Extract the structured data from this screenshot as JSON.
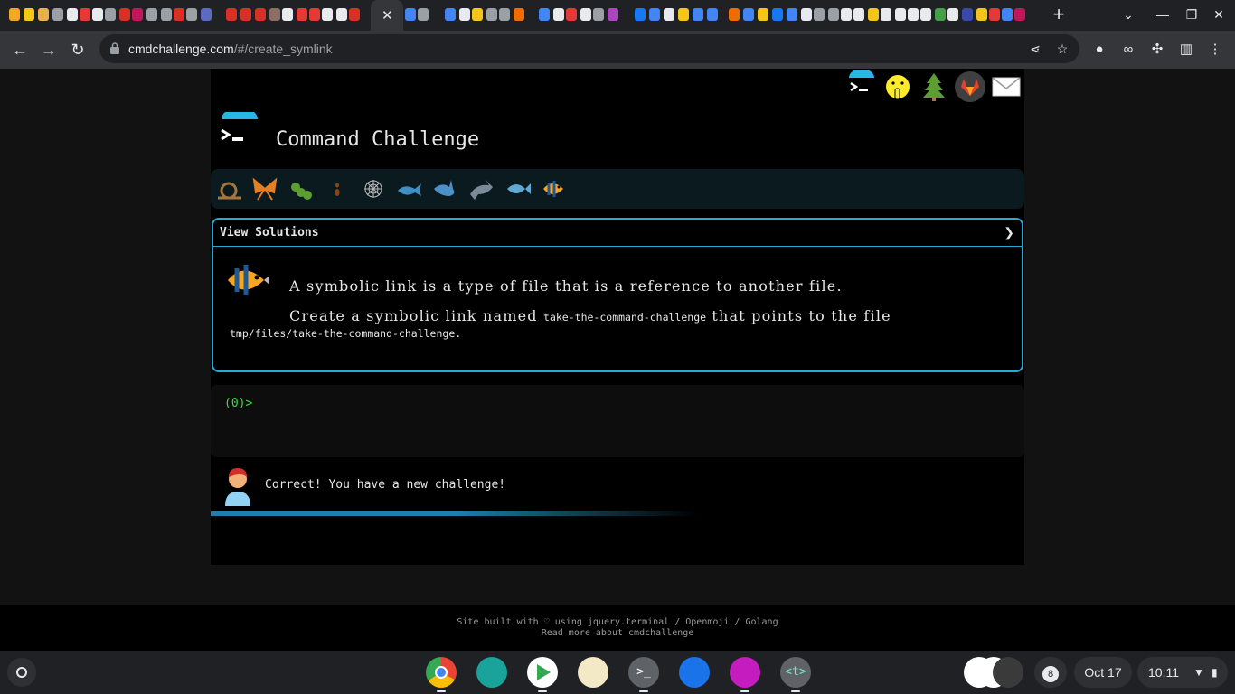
{
  "browser": {
    "url_host": "cmdchallenge.com",
    "url_path": "/#/create_symlink"
  },
  "site": {
    "title": "Command Challenge"
  },
  "panel": {
    "header": "View Solutions",
    "line1": "A symbolic link is a type of file that is a reference to another file.",
    "line2_prefix": "Create a symbolic link named ",
    "line2_code": "take-the-command-challenge",
    "line2_suffix": " that points to the file",
    "line3_code": "tmp/files/take-the-command-challenge",
    "line3_suffix": "."
  },
  "terminal": {
    "prompt": "(0)>"
  },
  "message": {
    "text": "Correct! You have a new challenge!"
  },
  "progress": {
    "fraction": 0.6
  },
  "footer": {
    "line1": "Site built with ♡ using jquery.terminal / Openmoji / Golang",
    "line2": "Read more about cmdchallenge"
  },
  "shelf": {
    "notification_count": "8",
    "date": "Oct 17",
    "time": "10:11"
  },
  "icons": {
    "levels": [
      "snail-icon",
      "butterfly-icon",
      "caterpillar-icon",
      "ant-icon",
      "spider-web-icon",
      "whale-icon",
      "shark-icon",
      "dolphin-icon",
      "fish-icon",
      "tropical-fish-icon"
    ],
    "top": [
      "terminal-icon",
      "shushing-face-icon",
      "tree-icon",
      "gitlab-icon",
      "envelope-icon"
    ]
  },
  "colors": {
    "accent": "#29a9d1",
    "prompt": "#3ddc3d",
    "background": "#000000"
  }
}
